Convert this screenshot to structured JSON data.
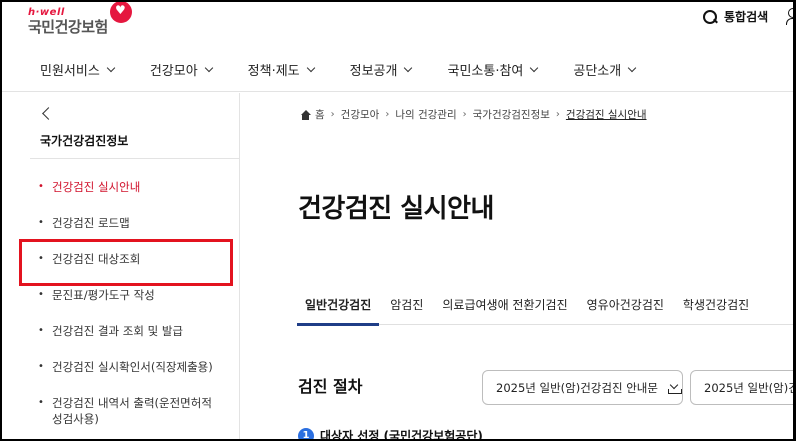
{
  "header": {
    "logo_small": "h·well",
    "logo_main": "국민건강보험",
    "search_label": "통합검색"
  },
  "gnb": {
    "items": [
      {
        "label": "민원서비스"
      },
      {
        "label": "건강모아"
      },
      {
        "label": "정책·제도"
      },
      {
        "label": "정보공개"
      },
      {
        "label": "국민소통·참여"
      },
      {
        "label": "공단소개"
      }
    ]
  },
  "sidebar": {
    "title": "국가건강검진정보",
    "items": [
      {
        "label": "건강검진 실시안내",
        "active": true
      },
      {
        "label": "건강검진 로드맵"
      },
      {
        "label": "건강검진 대상조회"
      },
      {
        "label": "문진표/평가도구 작성"
      },
      {
        "label": "건강검진 결과 조회 및 발급"
      },
      {
        "label": "건강검진 실시확인서(직장제출용)"
      },
      {
        "label": "건강검진 내역서 출력(운전면허적성검사용)"
      }
    ]
  },
  "breadcrumb": {
    "items": [
      "홈",
      "건강모아",
      "나의 건강관리",
      "국가건강검진정보",
      "건강검진 실시안내"
    ]
  },
  "main": {
    "title": "건강검진 실시안내",
    "tabs": [
      {
        "label": "일반건강검진",
        "active": true
      },
      {
        "label": "암검진"
      },
      {
        "label": "의료급여생애 전환기검진"
      },
      {
        "label": "영유아건강검진"
      },
      {
        "label": "학생건강검진"
      }
    ],
    "section_title": "검진 절차",
    "doc_buttons": [
      {
        "label": "2025년 일반(암)건강검진 안내문"
      },
      {
        "label": "2025년 일반(암)건강검진"
      }
    ],
    "step": {
      "number": "1",
      "text": "대상자 선정 (국민건강보험공단)"
    }
  },
  "colors": {
    "accent_red": "#d0112b",
    "tab_underline": "#1f3d87",
    "step_blue": "#2b6fe0",
    "highlight_red": "#e3131f"
  }
}
